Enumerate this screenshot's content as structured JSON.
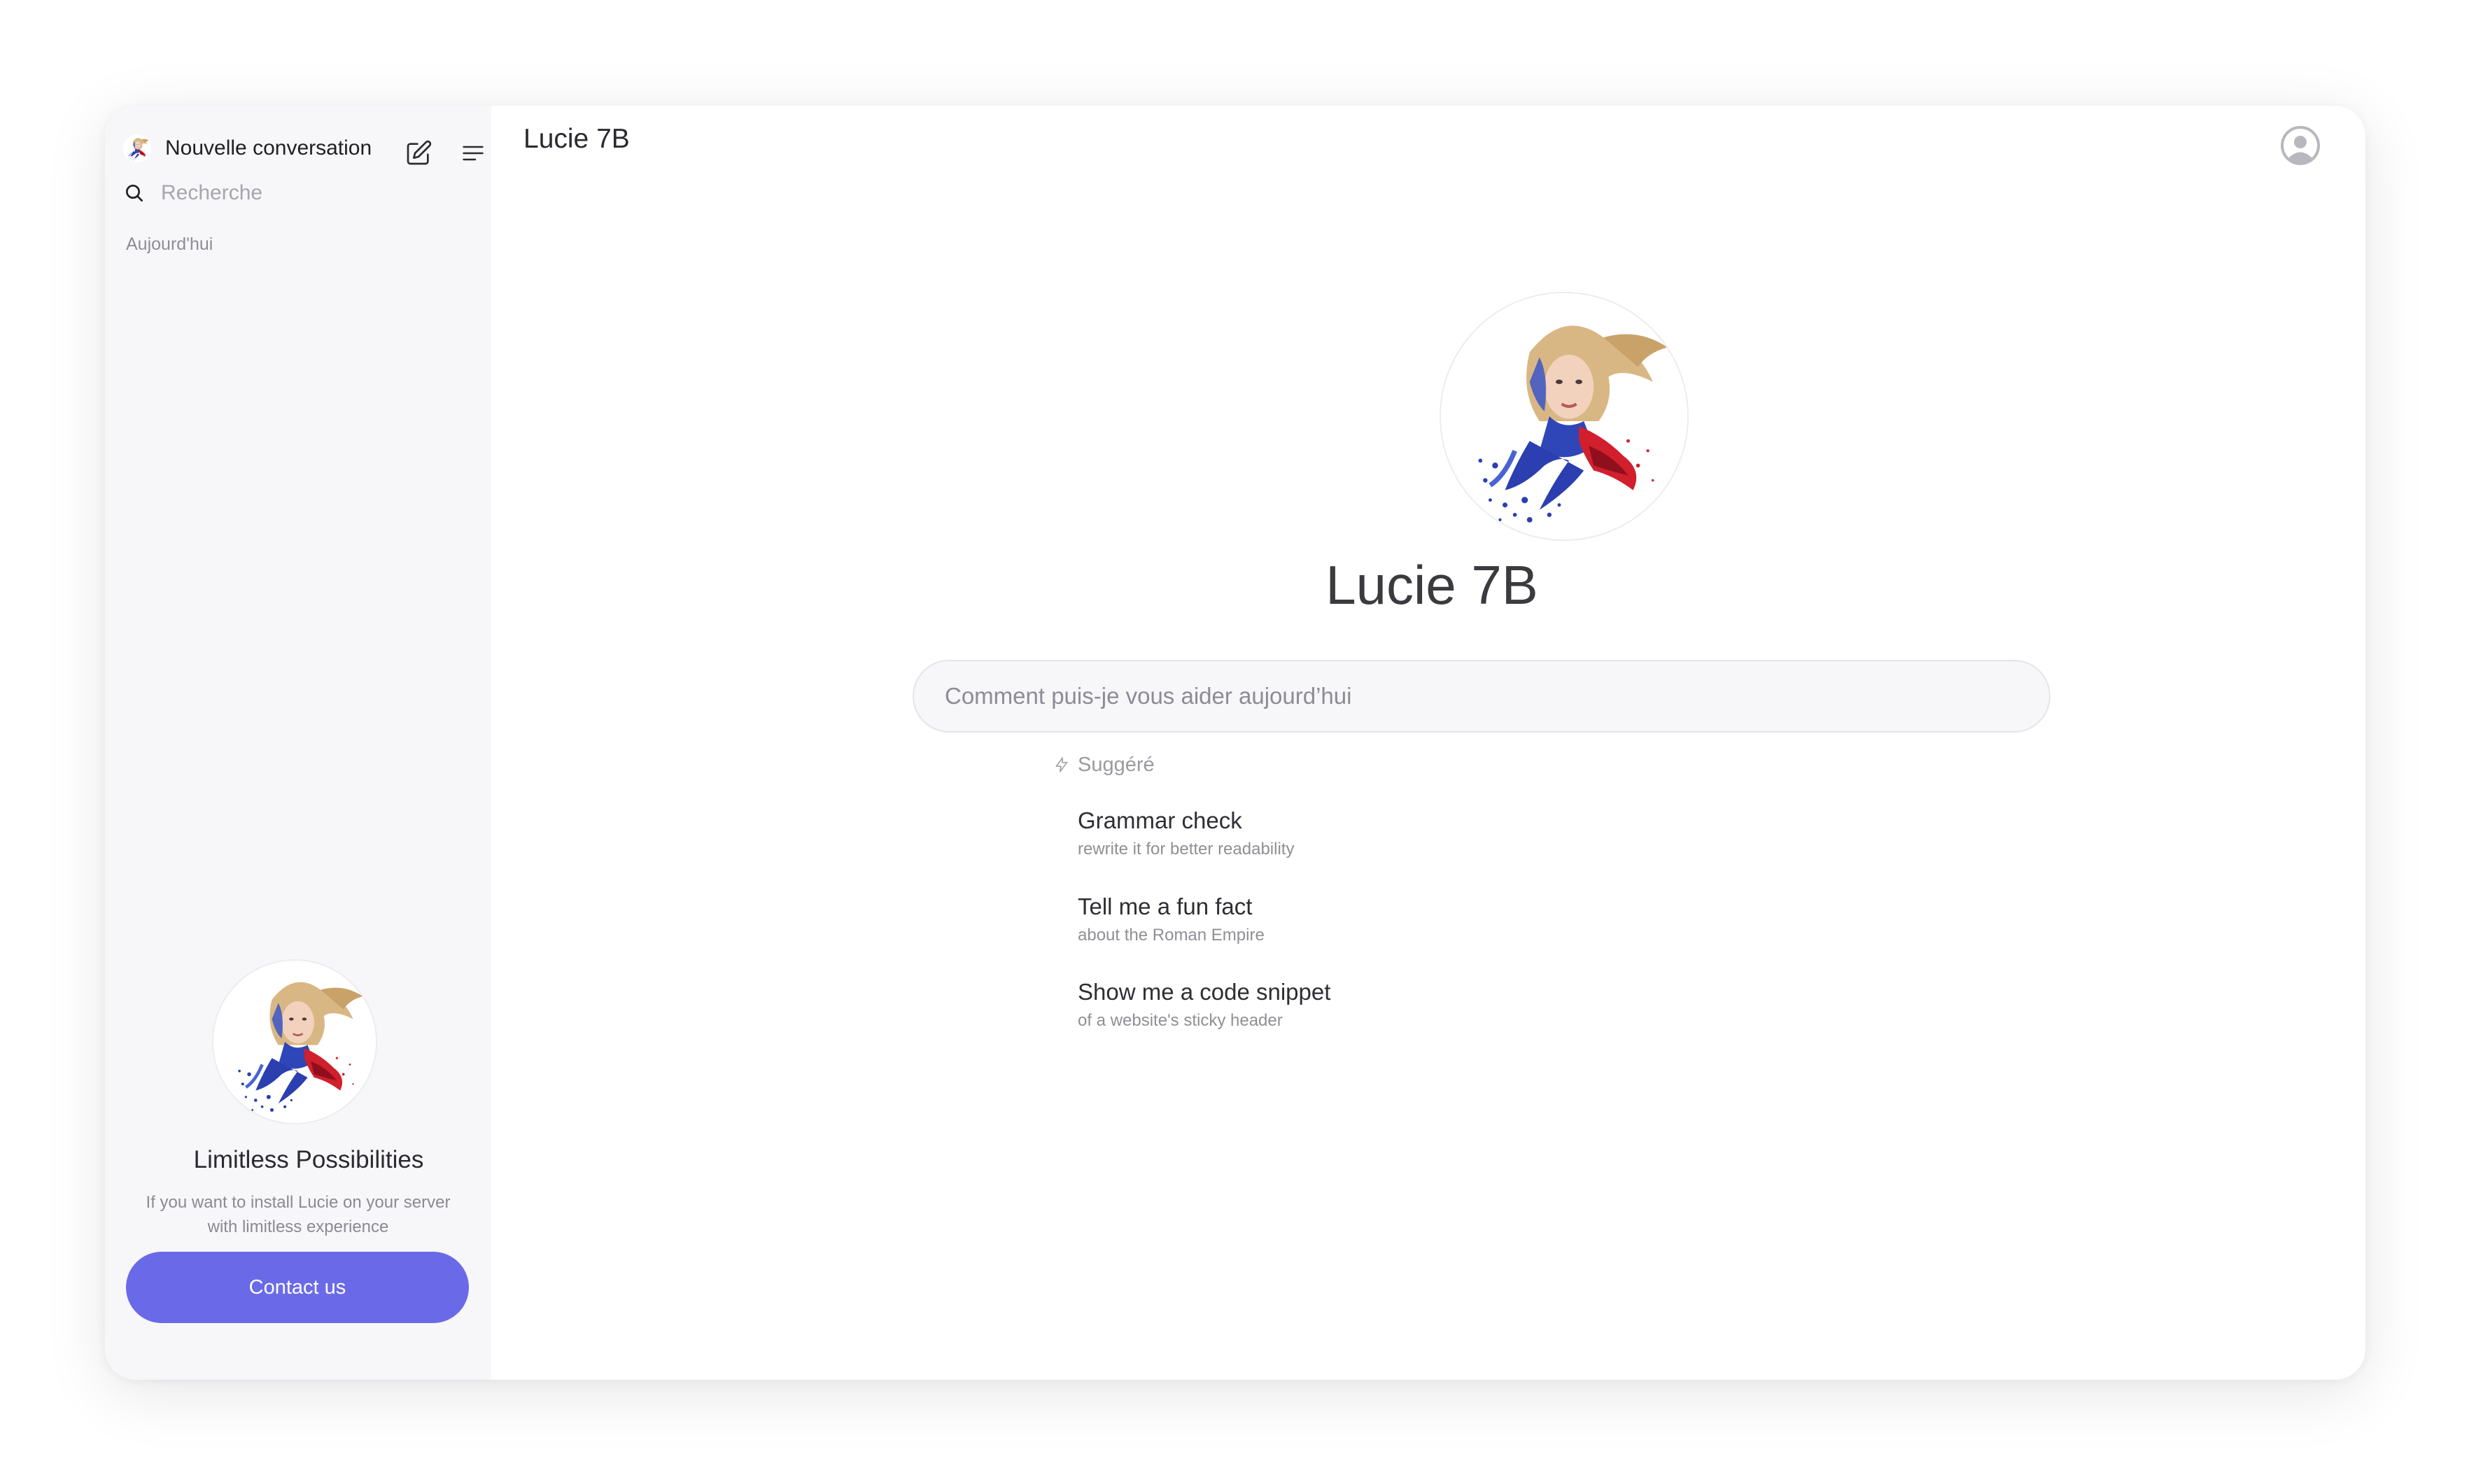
{
  "sidebar": {
    "new_chat_label": "Nouvelle conversation",
    "search_placeholder": "Recherche",
    "section_today": "Aujourd'hui",
    "promo": {
      "title": "Limitless Possibilities",
      "line1": "If you want to install  Lucie on your server",
      "line2": "with limitless experience",
      "button": "Contact us"
    }
  },
  "main": {
    "title": "Lucie 7B",
    "assistant_name": "Lucie 7B",
    "prompt_placeholder": "Comment puis-je vous aider aujourd’hui",
    "suggested_label": "Suggéré",
    "suggestions": [
      {
        "title": "Grammar check",
        "subtitle": "rewrite it for better readability"
      },
      {
        "title": "Tell me a fun fact",
        "subtitle": "about the Roman Empire"
      },
      {
        "title": "Show me a code snippet",
        "subtitle": "of a website's sticky header"
      }
    ]
  },
  "icons": {
    "logo": "lucie-logo-icon",
    "edit": "edit-pencil-icon",
    "menu": "menu-lines-icon",
    "search": "search-icon",
    "user": "user-avatar-icon",
    "suggest": "bolt-icon"
  },
  "colors": {
    "accent": "#6a6ae8",
    "sidebar_bg": "#f7f7f9",
    "text": "#2a2a30",
    "muted": "#8d8d94"
  }
}
